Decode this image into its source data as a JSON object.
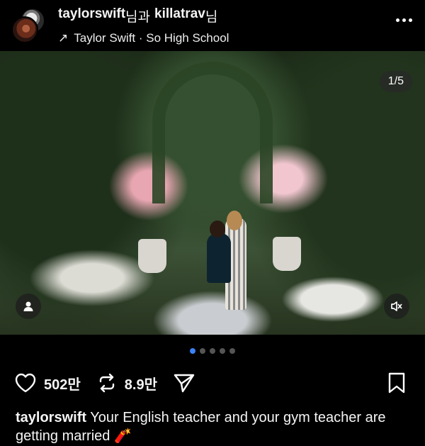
{
  "header": {
    "author1": "taylorswift",
    "conjunction": "님과",
    "author2": "killatrav",
    "suffix": "님",
    "audio_arrow": "↗",
    "audio": "Taylor Swift · So High School",
    "more_icon": "more-horizontal-icon"
  },
  "photo": {
    "counter": "1/5",
    "tag_icon": "person-icon",
    "mute_icon": "speaker-muted-icon"
  },
  "carousel": {
    "count": 5,
    "active": 1
  },
  "actions": {
    "likes": "502만",
    "reposts": "8.9만",
    "like_icon": "heart-icon",
    "repost_icon": "repost-icon",
    "share_icon": "send-icon",
    "save_icon": "bookmark-icon"
  },
  "caption": {
    "user": "taylorswift",
    "text": " Your English teacher and your gym teacher are getting married ",
    "emoji": "🧨"
  },
  "colors": {
    "background": "#000000",
    "active_dot": "#3b82f6",
    "inactive_dot": "#555555"
  }
}
